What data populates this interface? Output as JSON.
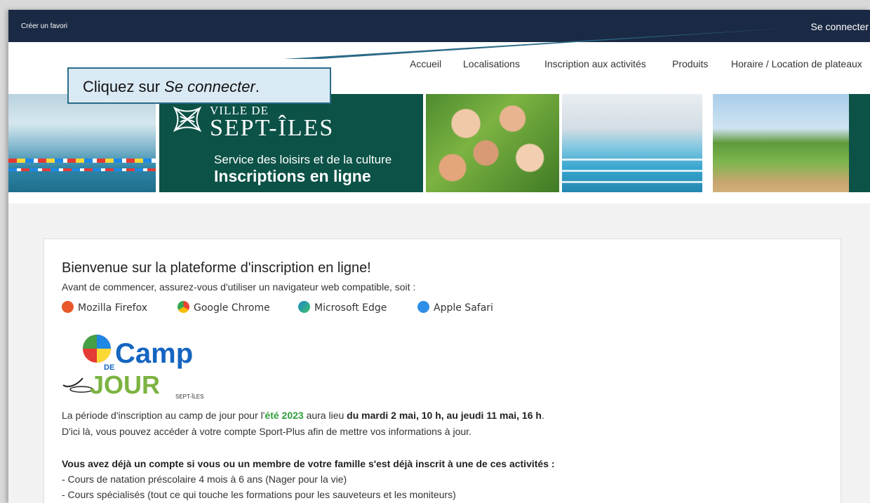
{
  "topbar": {
    "favorite_label": "Créer un favori",
    "login_label": "Se connecter"
  },
  "nav": [
    "Accueil",
    "Localisations",
    "Inscription aux activités",
    "Produits",
    "Horaire / Location de plateaux"
  ],
  "banner": {
    "ville": "VILLE DE",
    "city": "SEPT-ÎLES",
    "service": "Service des loisirs et de la culture",
    "inscriptions": "Inscriptions en ligne"
  },
  "content": {
    "welcome": "Bienvenue sur la plateforme d'inscription en ligne!",
    "intro": "Avant de commencer, assurez-vous d'utiliser un navigateur web compatible, soit :",
    "browsers": [
      {
        "name": "Mozilla Firefox",
        "icon": "firefox-icon",
        "color": "#e8582b"
      },
      {
        "name": "Google Chrome",
        "icon": "chrome-icon",
        "color": "#34a853"
      },
      {
        "name": "Microsoft Edge",
        "icon": "edge-icon",
        "color": "#1e88c8"
      },
      {
        "name": "Apple Safari",
        "icon": "safari-icon",
        "color": "#2f8fe8"
      }
    ],
    "camp_logo": {
      "camp": "Camp",
      "de": "DE",
      "jour": "JOUR",
      "city": "SEPT-ÎLES"
    },
    "period_text_1": "La période d'inscription au camp de jour pour l'",
    "period_highlight": "été 2023",
    "period_text_2": " aura lieu ",
    "period_dates": "du mardi 2 mai, 10 h, au jeudi 11 mai, 16 h",
    "period_end": ".",
    "account_text": "D'ici là, vous pouvez accéder à votre compte Sport-Plus afin de mettre vos informations à jour.",
    "existing_heading": "Vous avez déjà un compte si vous ou un membre de votre famille s'est déjà inscrit à une de ces activités :",
    "existing_items": [
      "- Cours de natation préscolaire 4 mois à 6 ans (Nager pour la vie)",
      "- Cours spécialisés (tout ce qui touche les formations pour les sauveteurs et les moniteurs)"
    ]
  },
  "callout": {
    "text_prefix": "Cliquez sur ",
    "text_em": "Se connecter",
    "text_suffix": "."
  },
  "colors": {
    "topbar": "#1b2a44",
    "brand_green": "#0c5246",
    "accent_green": "#2e9e3a",
    "callout_bg": "#daeaf5",
    "callout_border": "#2b6a86"
  }
}
